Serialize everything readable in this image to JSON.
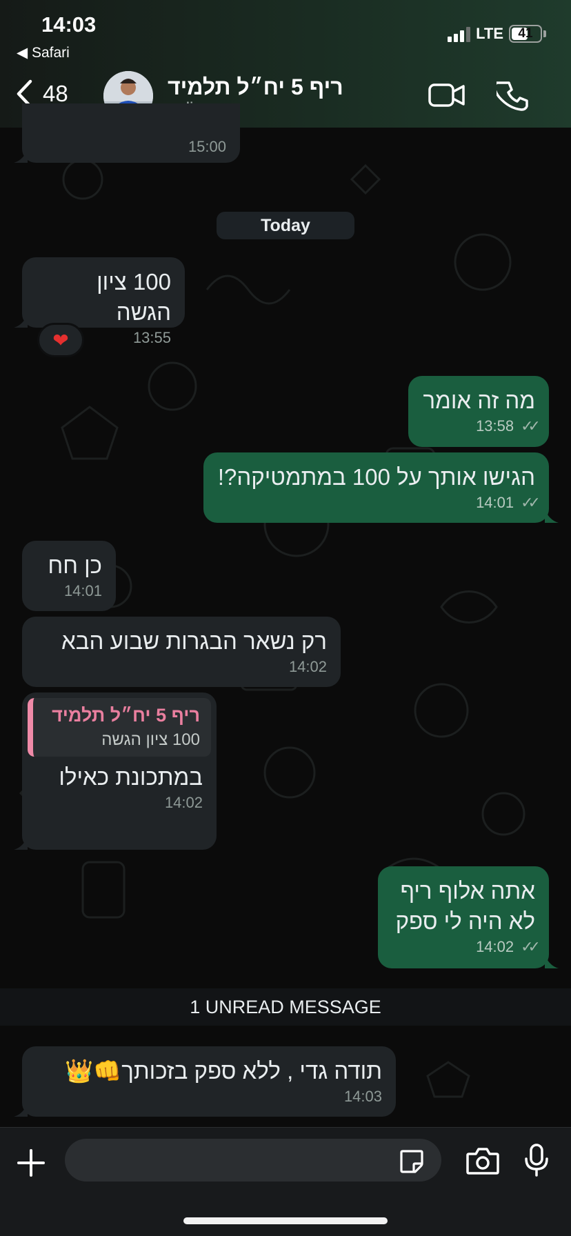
{
  "status_bar": {
    "time": "14:03",
    "back_app": "◀ Safari",
    "network": "LTE",
    "battery": "41"
  },
  "header": {
    "back_count": "48",
    "contact_name": "ריף 5 יח״ל תלמיד",
    "contact_status": "online"
  },
  "day_separator": "Today",
  "messages": [
    {
      "dir": "in",
      "text": "",
      "time": "15:00"
    },
    {
      "dir": "in",
      "text": "100 ציון הגשה",
      "time": "13:55",
      "reaction": "❤"
    },
    {
      "dir": "out",
      "text": "מה זה אומר",
      "time": "13:58",
      "ticks": "✓✓"
    },
    {
      "dir": "out",
      "text": "הגישו אותך על 100 במתמטיקה?!",
      "time": "14:01",
      "ticks": "✓✓"
    },
    {
      "dir": "in",
      "text": "כן חח",
      "time": "14:01"
    },
    {
      "dir": "in",
      "text": "רק נשאר הבגרות שבוע הבא",
      "time": "14:02"
    },
    {
      "dir": "in",
      "text": "במתכונת כאילו",
      "time": "14:02",
      "quote": {
        "author": "ריף 5 יח״ל תלמיד",
        "text": "100 ציון הגשה"
      }
    },
    {
      "dir": "out",
      "text": "אתה אלוף ריף\nלא היה לי ספק",
      "time": "14:02",
      "ticks": "✓✓"
    },
    {
      "dir": "in",
      "text": "תודה גדי , ללא ספק בזכותך👊👑",
      "time": "14:03"
    }
  ],
  "unread_banner": "1 UNREAD MESSAGE",
  "composer": {
    "placeholder": ""
  },
  "colors": {
    "incoming_bubble": "#202427",
    "outgoing_bubble": "#1a5e3f",
    "quote_accent": "#f08aa8"
  }
}
